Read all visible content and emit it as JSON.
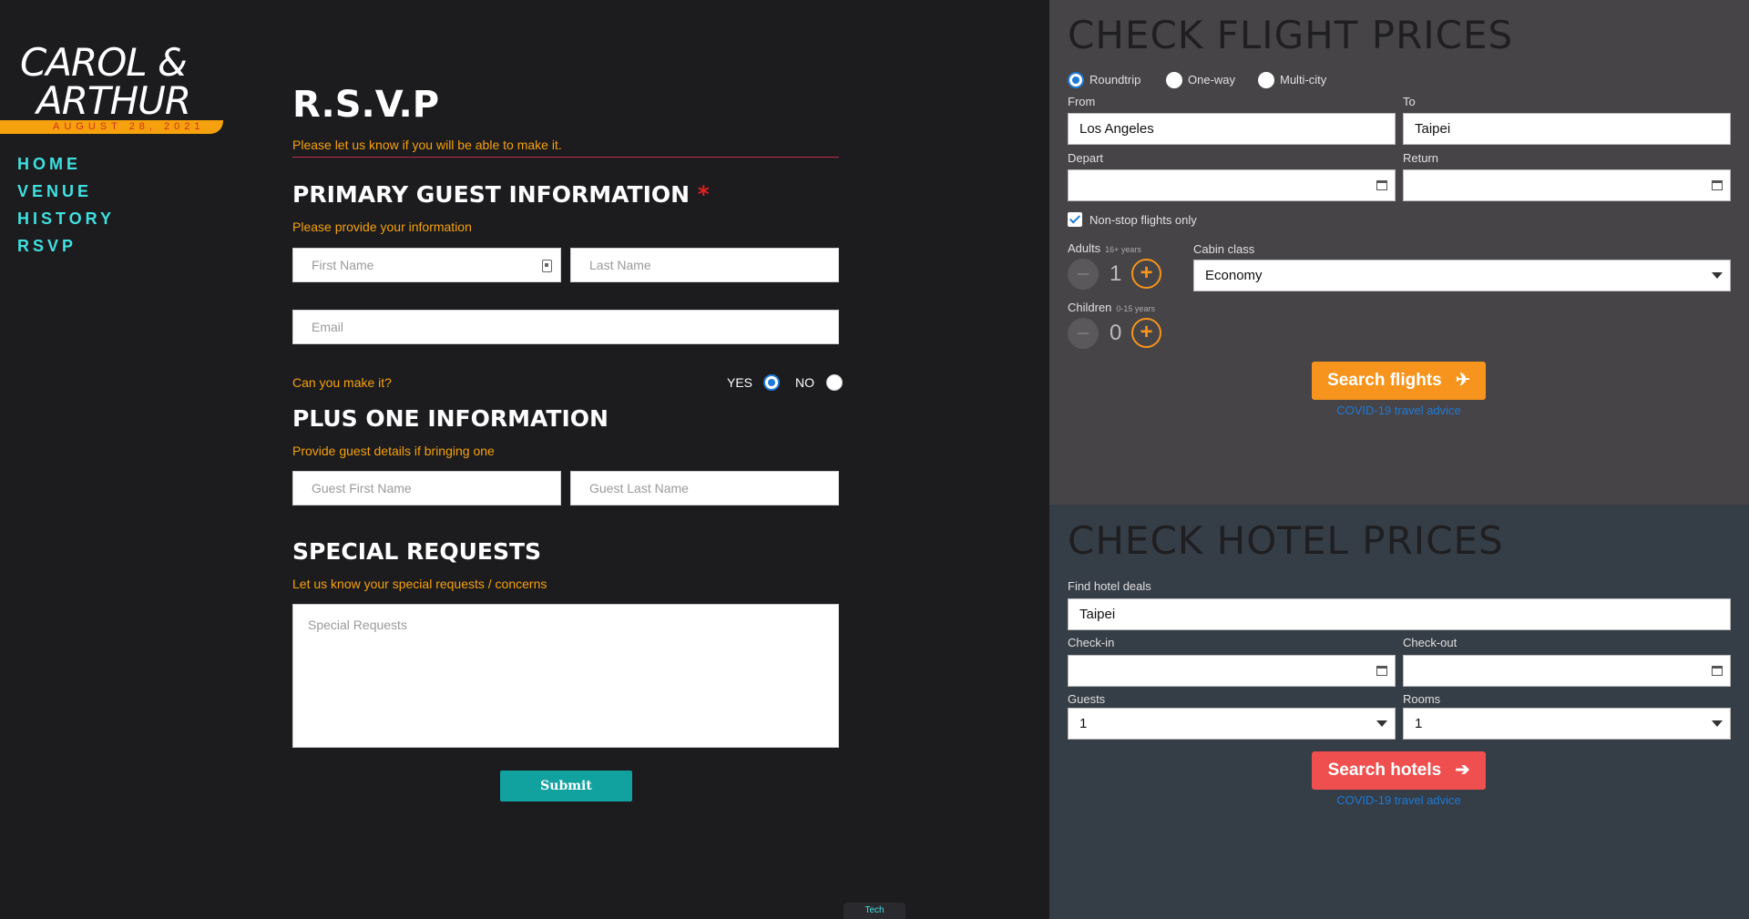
{
  "brand": {
    "line1": "CAROL &",
    "line2": "ARTHUR",
    "date": "AUGUST 28, 2021"
  },
  "nav": [
    "HOME",
    "VENUE",
    "HISTORY",
    "RSVP"
  ],
  "rsvp": {
    "title": "R.S.V.P",
    "subtitle": "Please let us know if you will be able to make it.",
    "primary_heading": "PRIMARY GUEST INFORMATION",
    "required_mark": "*",
    "primary_sub": "Please provide your information",
    "first_name_placeholder": "First Name",
    "last_name_placeholder": "Last Name",
    "email_placeholder": "Email",
    "attend_question": "Can you make it?",
    "yes_label": "YES",
    "no_label": "NO",
    "plus_heading": "PLUS ONE INFORMATION",
    "plus_sub": "Provide guest details if bringing one",
    "guest_first_placeholder": "Guest First Name",
    "guest_last_placeholder": "Guest Last Name",
    "special_heading": "SPECIAL REQUESTS",
    "special_sub": "Let us know your special requests / concerns",
    "special_placeholder": "Special Requests",
    "submit_label": "Submit"
  },
  "footer_tab": "Tech",
  "flight": {
    "title": "CHECK FLIGHT PRICES",
    "trip_types": [
      "Roundtrip",
      "One-way",
      "Multi-city"
    ],
    "selected_trip": "Roundtrip",
    "from_label": "From",
    "from_value": "Los Angeles",
    "to_label": "To",
    "to_value": "Taipei",
    "depart_label": "Depart",
    "return_label": "Return",
    "nonstop_label": "Non-stop flights only",
    "adults_label": "Adults",
    "adults_hint": "16+ years",
    "adults_count": "1",
    "children_label": "Children",
    "children_hint": "0-15 years",
    "children_count": "0",
    "cabin_label": "Cabin class",
    "cabin_value": "Economy",
    "search_label": "Search flights",
    "covid_link": "COVID-19 travel advice"
  },
  "hotel": {
    "title": "CHECK HOTEL PRICES",
    "find_label": "Find hotel deals",
    "find_value": "Taipei",
    "checkin_label": "Check-in",
    "checkout_label": "Check-out",
    "guests_label": "Guests",
    "guests_value": "1",
    "rooms_label": "Rooms",
    "rooms_value": "1",
    "search_label": "Search hotels",
    "covid_link": "COVID-19 travel advice"
  },
  "colors": {
    "accent_orange": "#f5a10d",
    "nav_cyan": "#3fe0e0",
    "submit_teal": "#11a2a0",
    "flight_button": "#f7941d",
    "hotel_button": "#ef4f4f",
    "link_blue": "#1e7ad8"
  }
}
